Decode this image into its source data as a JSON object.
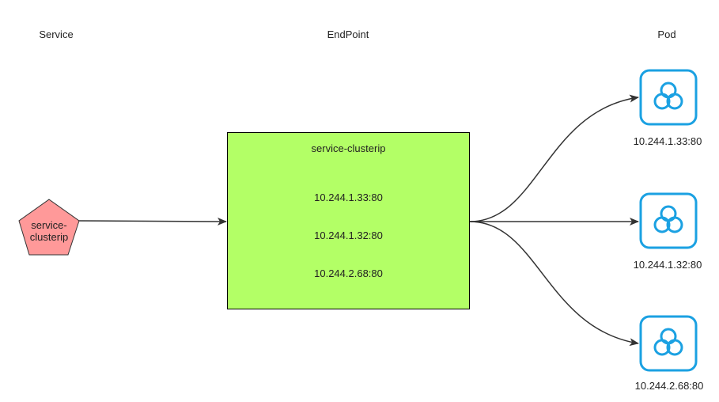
{
  "headers": {
    "service": "Service",
    "endpoint": "EndPoint",
    "pod": "Pod"
  },
  "service": {
    "label": "service-\nclusterip",
    "shape": "pentagon",
    "fill": "#FF9999",
    "stroke": "#333333"
  },
  "endpoint": {
    "title": "service-clusterip",
    "addresses": [
      "10.244.1.33:80",
      "10.244.1.32:80",
      "10.244.2.68:80"
    ],
    "fill": "#B3FF66",
    "stroke": "#000000"
  },
  "pods": [
    {
      "label": "10.244.1.33:80",
      "icon": "kubernetes-pod-cycle-icon"
    },
    {
      "label": "10.244.1.32:80",
      "icon": "kubernetes-pod-cycle-icon"
    },
    {
      "label": "10.244.2.68:80",
      "icon": "kubernetes-pod-cycle-icon"
    }
  ],
  "colors": {
    "pod_icon": "#1BA1E2",
    "connector": "#333333"
  }
}
